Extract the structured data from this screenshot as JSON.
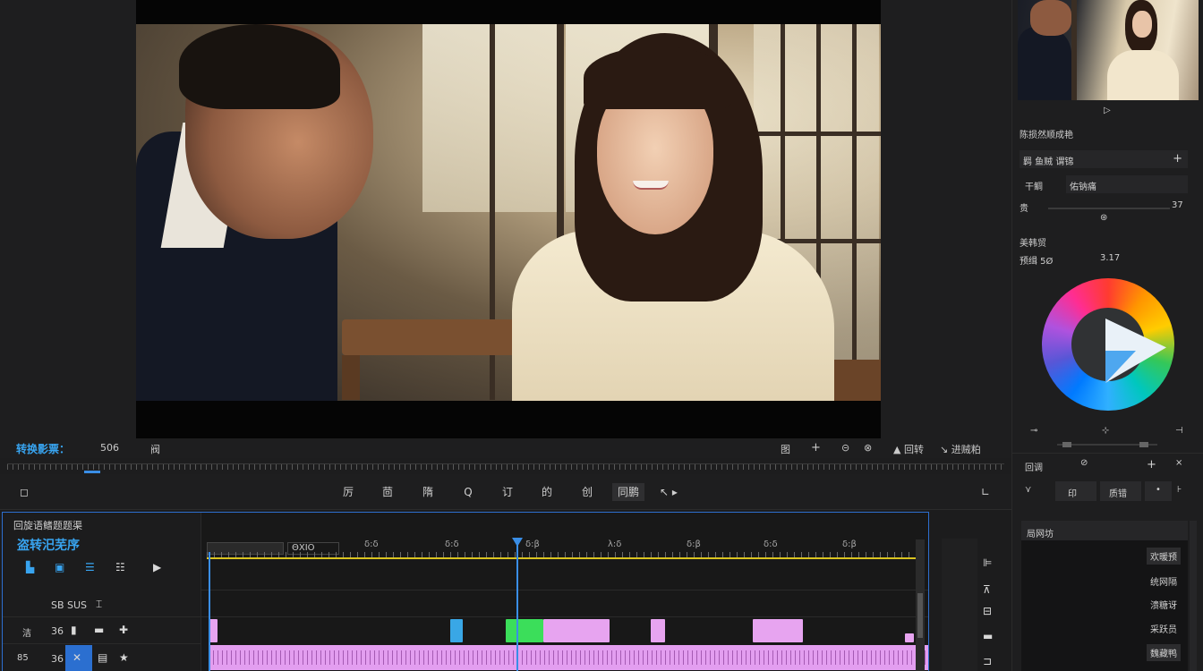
{
  "viewer": {
    "label": "转换影票：",
    "timecode": "506",
    "zoom": "阀",
    "controls": [
      "图",
      "+",
      "⊝",
      "⊗",
      "▲ 回转",
      "↘ 进贼粕"
    ]
  },
  "toolbar": {
    "tools": [
      "厉",
      "茴",
      "隋",
      "Q",
      "订",
      "的",
      "创",
      "同鹏",
      "↖ ▸"
    ]
  },
  "timeline": {
    "title": "回旋语鳍题题渠",
    "subtitle": "盗转汜芜序",
    "timecode_box": "ΘXIO",
    "ticks": [
      "δ:δ",
      "δ:δ",
      "δ:β",
      "λ:δ",
      "δ:β",
      "δ:δ",
      "δ:β",
      "δ:δ"
    ],
    "track1_label": "SB SUS",
    "track2_num": "36",
    "track3_num": "36",
    "track2_name": "洁",
    "track3_name": "85"
  },
  "right_panel": {
    "section_title": "陈损然顺成艳",
    "row1_label": "羁 鱼贼 谓锦",
    "row2_label": "干鲷",
    "row2_value": "佑钠痛",
    "row3_label": "贵",
    "row3_value": "37",
    "color_title": "美韩贸",
    "color_label": "预缉 5Ø",
    "color_value": "3.17",
    "bottom_tools": [
      "回调",
      "印",
      "质错"
    ],
    "list_title": "局网坊",
    "list_items": [
      "欢暖预",
      "统网隔",
      "溃糖讶",
      "采跃员",
      "魏藏鸭"
    ]
  }
}
